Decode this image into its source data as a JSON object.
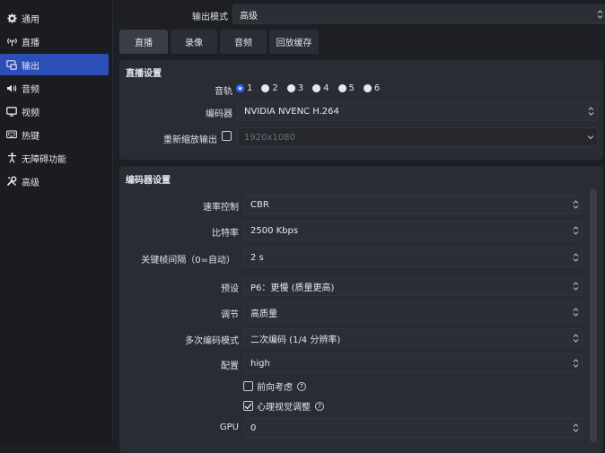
{
  "sidebar": {
    "items": [
      {
        "label": "通用",
        "icon": "gear-icon"
      },
      {
        "label": "直播",
        "icon": "broadcast-icon"
      },
      {
        "label": "输出",
        "icon": "output-icon"
      },
      {
        "label": "音频",
        "icon": "speaker-icon"
      },
      {
        "label": "视频",
        "icon": "monitor-icon"
      },
      {
        "label": "热键",
        "icon": "keyboard-icon"
      },
      {
        "label": "无障碍功能",
        "icon": "accessibility-icon"
      },
      {
        "label": "高级",
        "icon": "wrench-icon"
      }
    ],
    "active_index": 2
  },
  "output_mode": {
    "label": "输出模式",
    "value": "高级"
  },
  "tabs": [
    "直播",
    "录像",
    "音频",
    "回放缓存"
  ],
  "active_tab": 0,
  "stream_settings": {
    "title": "直播设置",
    "audio_track_label": "音轨",
    "tracks": [
      "1",
      "2",
      "3",
      "4",
      "5",
      "6"
    ],
    "selected_track": "1",
    "encoder_label": "编码器",
    "encoder_value": "NVIDIA NVENC H.264",
    "rescale_label": "重新缩放输出",
    "rescale_value": "1920x1080"
  },
  "encoder_settings": {
    "title": "编码器设置",
    "rate_control": {
      "label": "速率控制",
      "value": "CBR"
    },
    "bitrate": {
      "label": "比特率",
      "value": "2500 Kbps"
    },
    "keyframe": {
      "label": "关键帧间隔（0=自动）",
      "value": "2 s"
    },
    "preset": {
      "label": "预设",
      "value": "P6：更慢 (质量更高)"
    },
    "tuning": {
      "label": "调节",
      "value": "高质量"
    },
    "multipass": {
      "label": "多次编码模式",
      "value": "二次编码 (1/4 分辨率)"
    },
    "profile": {
      "label": "配置",
      "value": "high"
    },
    "lookahead": {
      "label": "前向考虑",
      "checked": false
    },
    "psycho_visual": {
      "label": "心理视觉调整",
      "checked": true
    },
    "gpu": {
      "label": "GPU",
      "value": "0"
    }
  },
  "colors": {
    "accent": "#2b4fb6",
    "panel": "#2a2c33",
    "background": "#1e1f24"
  }
}
